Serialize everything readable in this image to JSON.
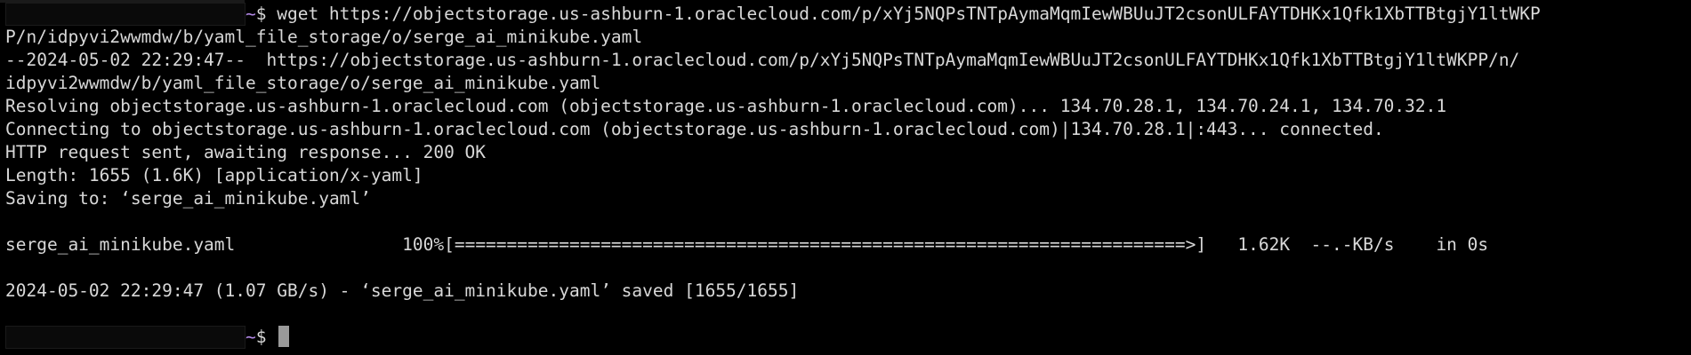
{
  "terminal": {
    "prompt_tilde": "~",
    "prompt_symbol": "$ ",
    "command": "wget https://objectstorage.us-ashburn-1.oraclecloud.com/p/xYj5NQPsTNTpAymaMqmIewWBUuJT2csonULFAYTDHKx1Qfk1XbTTBtgjY1ltWKP",
    "command_cont": "P/n/idpyvi2wwmdw/b/yaml_file_storage/o/serge_ai_minikube.yaml",
    "out_1": "--2024-05-02 22:29:47--  https://objectstorage.us-ashburn-1.oraclecloud.com/p/xYj5NQPsTNTpAymaMqmIewWBUuJT2csonULFAYTDHKx1Qfk1XbTTBtgjY1ltWKPP/n/",
    "out_2": "idpyvi2wwmdw/b/yaml_file_storage/o/serge_ai_minikube.yaml",
    "out_3": "Resolving objectstorage.us-ashburn-1.oraclecloud.com (objectstorage.us-ashburn-1.oraclecloud.com)... 134.70.28.1, 134.70.24.1, 134.70.32.1",
    "out_4": "Connecting to objectstorage.us-ashburn-1.oraclecloud.com (objectstorage.us-ashburn-1.oraclecloud.com)|134.70.28.1|:443... connected.",
    "out_5": "HTTP request sent, awaiting response... 200 OK",
    "out_6": "Length: 1655 (1.6K) [application/x-yaml]",
    "out_7": "Saving to: ‘serge_ai_minikube.yaml’",
    "progress": {
      "filename": "serge_ai_minikube.yaml",
      "percent": "100%",
      "bar": "[======================================================================>]",
      "size": "1.62K",
      "speed": "--.-KB/s",
      "time": "in 0s"
    },
    "out_saved": "2024-05-02 22:29:47 (1.07 GB/s) - ‘serge_ai_minikube.yaml’ saved [1655/1655]"
  },
  "colors": {
    "background": "#000000",
    "text": "#d8d8d8",
    "prompt_tilde": "#b48ae8",
    "cursor": "#9a9a9a"
  }
}
